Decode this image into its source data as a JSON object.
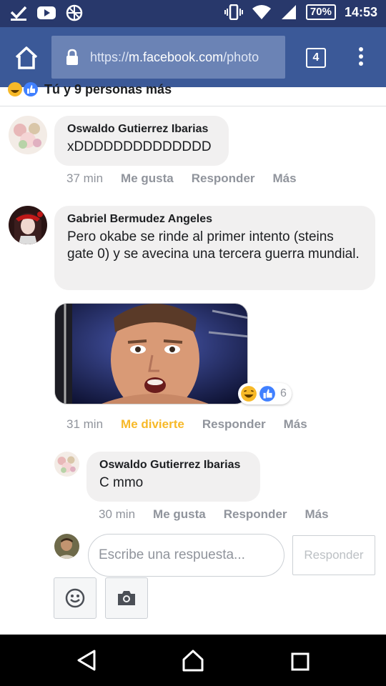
{
  "status_bar": {
    "battery": "70%",
    "time": "14:53"
  },
  "browser": {
    "url_scheme": "https://",
    "url_host": "m.facebook.com",
    "url_path": "/photo",
    "tab_count": "4"
  },
  "reactions_summary": {
    "text": "Tú y 9 personas más"
  },
  "comments": [
    {
      "author": "Oswaldo Gutierrez Ibarias",
      "text": "xDDDDDDDDDDDDDD",
      "time": "37 min",
      "like_label": "Me gusta",
      "reply_label": "Responder",
      "more_label": "Más"
    },
    {
      "author": "Gabriel Bermudez Angeles",
      "text": "Pero okabe se rinde al primer intento (steins gate 0) y se avecina una tercera guerra mundial.",
      "reaction_count": "6",
      "time": "31 min",
      "like_label": "Me divierte",
      "reply_label": "Responder",
      "more_label": "Más"
    }
  ],
  "reply": {
    "author": "Oswaldo Gutierrez Ibarias",
    "text": "C mmo",
    "time": "30 min",
    "like_label": "Me gusta",
    "reply_label": "Responder",
    "more_label": "Más"
  },
  "composer": {
    "placeholder": "Escribe una respuesta...",
    "submit_label": "Responder"
  },
  "colors": {
    "facebook_blue": "#3b5998",
    "status_bar": "#28386b",
    "haha_yellow": "#f7b928",
    "bubble_bg": "#f1f0f0"
  },
  "icons": [
    "check-icon",
    "youtube-icon",
    "no-signal-icon",
    "vibrate-icon",
    "wifi-icon",
    "cell-signal-icon",
    "home-icon",
    "lock-icon",
    "overflow-menu-icon",
    "haha-reaction-icon",
    "like-reaction-icon",
    "emoji-icon",
    "camera-icon",
    "back-icon",
    "recents-icon"
  ]
}
